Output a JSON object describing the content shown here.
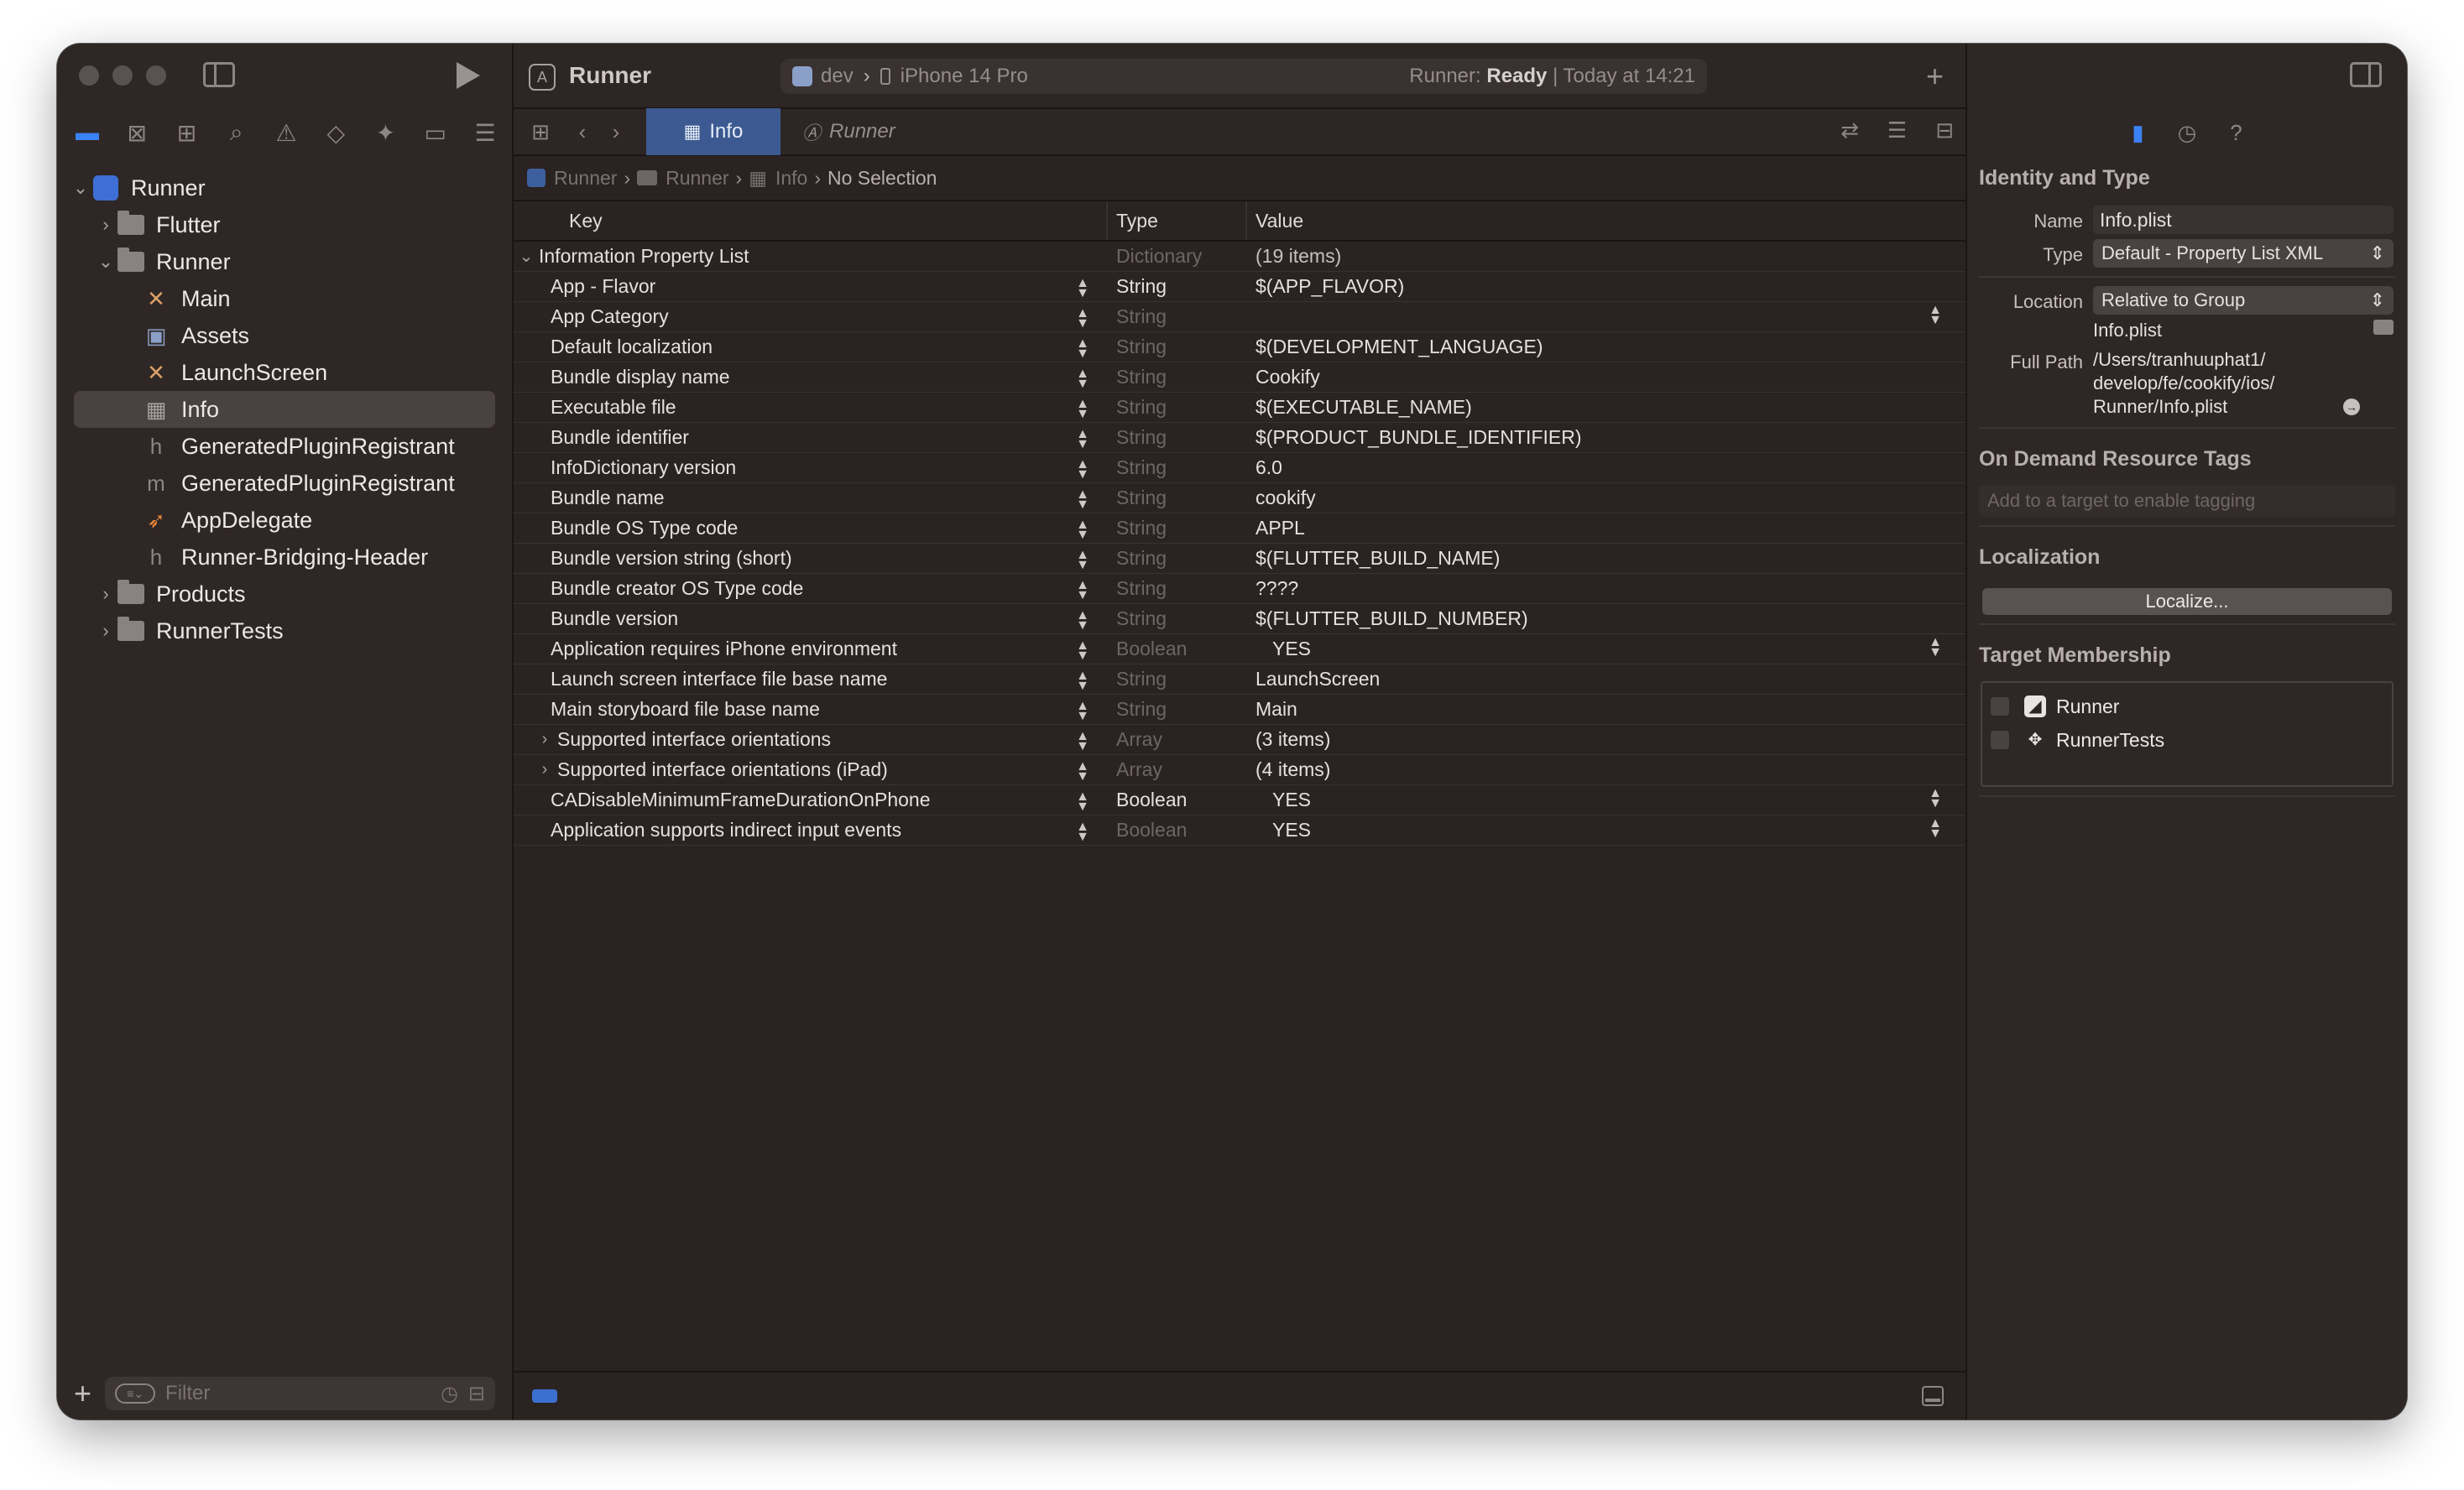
{
  "navigator": {
    "filter_placeholder": "Filter",
    "tree": [
      {
        "label": "Runner",
        "depth": 0,
        "disclosure": "⌄",
        "icon": "project"
      },
      {
        "label": "Flutter",
        "depth": 1,
        "disclosure": "›",
        "icon": "folder"
      },
      {
        "label": "Runner",
        "depth": 1,
        "disclosure": "⌄",
        "icon": "folder"
      },
      {
        "label": "Main",
        "depth": 2,
        "disclosure": "",
        "icon": "storyboard"
      },
      {
        "label": "Assets",
        "depth": 2,
        "disclosure": "",
        "icon": "assets"
      },
      {
        "label": "LaunchScreen",
        "depth": 2,
        "disclosure": "",
        "icon": "storyboard"
      },
      {
        "label": "Info",
        "depth": 2,
        "disclosure": "",
        "icon": "plist",
        "selected": true
      },
      {
        "label": "GeneratedPluginRegistrant",
        "depth": 2,
        "disclosure": "",
        "icon": "header"
      },
      {
        "label": "GeneratedPluginRegistrant",
        "depth": 2,
        "disclosure": "",
        "icon": "objc"
      },
      {
        "label": "AppDelegate",
        "depth": 2,
        "disclosure": "",
        "icon": "swift"
      },
      {
        "label": "Runner-Bridging-Header",
        "depth": 2,
        "disclosure": "",
        "icon": "header"
      },
      {
        "label": "Products",
        "depth": 1,
        "disclosure": "›",
        "icon": "folder"
      },
      {
        "label": "RunnerTests",
        "depth": 1,
        "disclosure": "›",
        "icon": "folder"
      }
    ]
  },
  "toolbar": {
    "project_title": "Runner",
    "scheme": "dev",
    "device": "iPhone 14 Pro",
    "status_prefix": "Runner:",
    "status_state": "Ready",
    "status_time": "| Today at 14:21"
  },
  "tabs": {
    "active": "Info",
    "inactive": "Runner"
  },
  "breadcrumb": [
    "Runner",
    "Runner",
    "Info",
    "No Selection"
  ],
  "plist": {
    "headers": {
      "key": "Key",
      "type": "Type",
      "value": "Value"
    },
    "rows": [
      {
        "key": "Information Property List",
        "type": "Dictionary",
        "value": "(19 items)",
        "root": true,
        "dim": true
      },
      {
        "key": "App - Flavor",
        "type": "String",
        "value": "$(APP_FLAVOR)",
        "dim": false
      },
      {
        "key": "App Category",
        "type": "String",
        "value": "",
        "dim": true,
        "vstep": true
      },
      {
        "key": "Default localization",
        "type": "String",
        "value": "$(DEVELOPMENT_LANGUAGE)",
        "dim": true
      },
      {
        "key": "Bundle display name",
        "type": "String",
        "value": "Cookify",
        "dim": true
      },
      {
        "key": "Executable file",
        "type": "String",
        "value": "$(EXECUTABLE_NAME)",
        "dim": true
      },
      {
        "key": "Bundle identifier",
        "type": "String",
        "value": "$(PRODUCT_BUNDLE_IDENTIFIER)",
        "dim": true
      },
      {
        "key": "InfoDictionary version",
        "type": "String",
        "value": "6.0",
        "dim": true
      },
      {
        "key": "Bundle name",
        "type": "String",
        "value": "cookify",
        "dim": true
      },
      {
        "key": "Bundle OS Type code",
        "type": "String",
        "value": "APPL",
        "dim": true
      },
      {
        "key": "Bundle version string (short)",
        "type": "String",
        "value": "$(FLUTTER_BUILD_NAME)",
        "dim": true
      },
      {
        "key": "Bundle creator OS Type code",
        "type": "String",
        "value": "????",
        "dim": true
      },
      {
        "key": "Bundle version",
        "type": "String",
        "value": "$(FLUTTER_BUILD_NUMBER)",
        "dim": true
      },
      {
        "key": "Application requires iPhone environment",
        "type": "Boolean",
        "value": "YES",
        "dim": true,
        "bool": true,
        "vstep": true
      },
      {
        "key": "Launch screen interface file base name",
        "type": "String",
        "value": "LaunchScreen",
        "dim": true
      },
      {
        "key": "Main storyboard file base name",
        "type": "String",
        "value": "Main",
        "dim": true
      },
      {
        "key": "Supported interface orientations",
        "type": "Array",
        "value": "(3 items)",
        "dim": true,
        "expandable": true
      },
      {
        "key": "Supported interface orientations (iPad)",
        "type": "Array",
        "value": "(4 items)",
        "dim": true,
        "expandable": true
      },
      {
        "key": "CADisableMinimumFrameDurationOnPhone",
        "type": "Boolean",
        "value": "YES",
        "dim": false,
        "bool": true,
        "vstep": true
      },
      {
        "key": "Application supports indirect input events",
        "type": "Boolean",
        "value": "YES",
        "dim": true,
        "bool": true,
        "vstep": true
      }
    ]
  },
  "inspector": {
    "identity_title": "Identity and Type",
    "name_label": "Name",
    "name_value": "Info.plist",
    "type_label": "Type",
    "type_value": "Default - Property List XML",
    "location_label": "Location",
    "location_value": "Relative to Group",
    "location_file": "Info.plist",
    "fullpath_label": "Full Path",
    "fullpath_value": "/Users/tranhuuphat1/ develop/fe/cookify/ios/ Runner/Info.plist",
    "odr_title": "On Demand Resource Tags",
    "odr_placeholder": "Add to a target to enable tagging",
    "localization_title": "Localization",
    "localize_button": "Localize...",
    "membership_title": "Target Membership",
    "targets": [
      "Runner",
      "RunnerTests"
    ]
  },
  "colors": {
    "accent": "#3b82f6",
    "selected_tab": "#3c5a91",
    "window_bg": "#2a2321"
  }
}
